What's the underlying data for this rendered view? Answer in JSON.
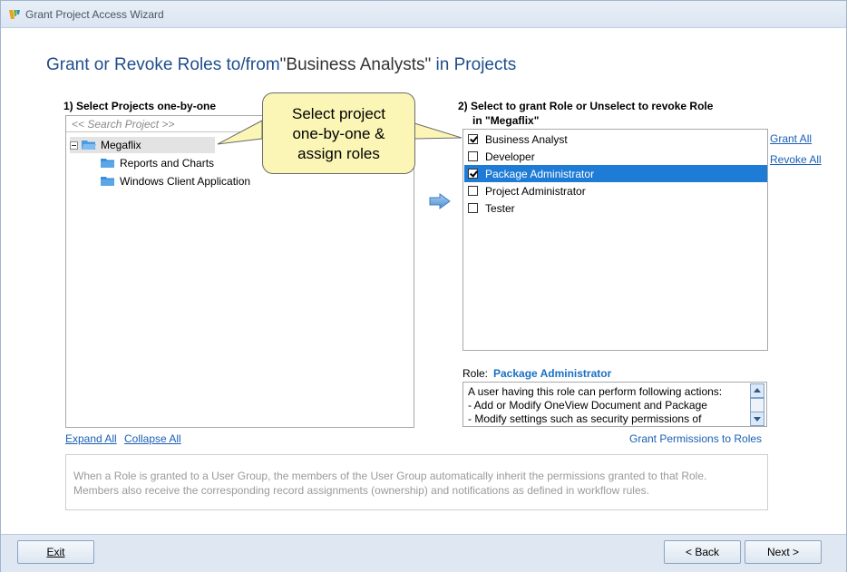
{
  "window": {
    "title": "Grant Project Access Wizard"
  },
  "heading": {
    "prefix": "Grant or Revoke Roles to/from",
    "group": "\"Business Analysts\"",
    "suffix": " in Projects"
  },
  "projects": {
    "label": "1) Select Projects one-by-one",
    "search_placeholder": "<< Search Project >>",
    "tree": [
      {
        "label": "Megaflix",
        "expanded": true,
        "selected": true
      },
      {
        "label": "Reports and Charts"
      },
      {
        "label": "Windows Client Application"
      }
    ],
    "expand_all": "Expand All",
    "collapse_all": "Collapse All"
  },
  "callout": {
    "lines": [
      "Select project",
      "one-by-one &",
      "assign roles"
    ]
  },
  "roles": {
    "label_line1": "2) Select to grant Role or Unselect to revoke Role",
    "label_line2": "in \"Megaflix\"",
    "items": [
      {
        "label": "Business Analyst",
        "checked": true,
        "selected": false
      },
      {
        "label": "Developer",
        "checked": false,
        "selected": false
      },
      {
        "label": "Package Administrator",
        "checked": true,
        "selected": true
      },
      {
        "label": "Project Administrator",
        "checked": false,
        "selected": false
      },
      {
        "label": "Tester",
        "checked": false,
        "selected": false
      }
    ],
    "grant_all": "Grant All",
    "revoke_all": "Revoke All"
  },
  "role_detail": {
    "label": "Role:",
    "value": "Package Administrator",
    "description": [
      "A user having this role can perform following actions:",
      "- Add or Modify OneView Document and Package",
      "- Modify settings such as security permissions of"
    ],
    "grant_permissions_link": "Grant Permissions to Roles"
  },
  "info_text": [
    "When a Role is granted to a User Group, the members of the User Group automatically inherit the permissions granted to that Role.",
    "Members also receive the corresponding record assignments (ownership) and notifications as defined in workflow rules."
  ],
  "footer": {
    "exit_label": "Exit",
    "back_label": "< Back",
    "next_label": "Next >"
  },
  "colors": {
    "accent": "#1e7bd6",
    "heading": "#1f4e8c",
    "callout": "#fbf6b5",
    "link": "#1a5fb4"
  }
}
